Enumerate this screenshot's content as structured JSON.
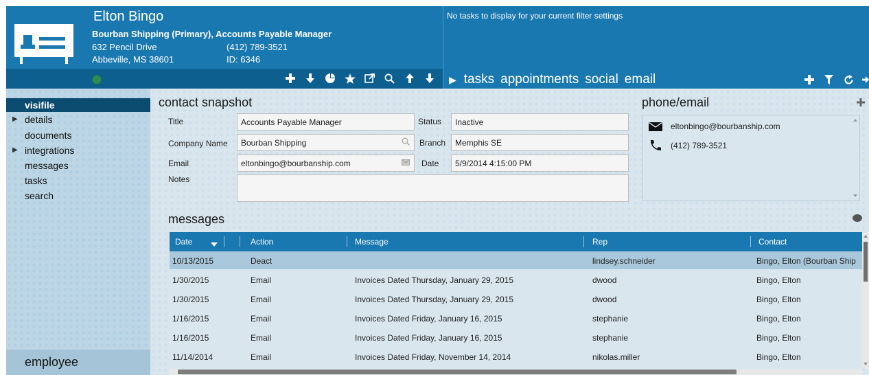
{
  "contact": {
    "name": "Elton Bingo",
    "company_line": "Bourban Shipping  (Primary), Accounts Payable Manager",
    "address1": "632 Pencil Drive",
    "address2": "Abbeville, MS  38601",
    "phone": "(412) 789-3521",
    "id": "ID:  6346",
    "status_color": "#2e8b57"
  },
  "card_toolbar": {
    "icons": [
      "plus-icon",
      "arrow-down-icon",
      "pie-icon",
      "star-icon",
      "external-link-icon",
      "search-icon",
      "arrow-up-icon",
      "arrow-down-icon"
    ]
  },
  "tasks": {
    "empty_message": "No tasks to display for your current filter settings",
    "tabs": [
      "tasks",
      "appointments",
      "social",
      "email"
    ],
    "tools": [
      "plus-icon",
      "filter-icon",
      "refresh-icon",
      "arrow-right-icon"
    ]
  },
  "nav": {
    "items": [
      {
        "label": "visifile",
        "active": true,
        "expandable": false
      },
      {
        "label": "details",
        "active": false,
        "expandable": true
      },
      {
        "label": "documents",
        "active": false,
        "expandable": false
      },
      {
        "label": "integrations",
        "active": false,
        "expandable": true
      },
      {
        "label": "messages",
        "active": false,
        "expandable": false
      },
      {
        "label": "tasks",
        "active": false,
        "expandable": false
      },
      {
        "label": "search",
        "active": false,
        "expandable": false
      }
    ],
    "footer": "employee"
  },
  "snapshot": {
    "title": "contact snapshot",
    "fields": {
      "title_label": "Title",
      "title_value": "Accounts Payable Manager",
      "company_label": "Company Name",
      "company_value": "Bourban Shipping",
      "email_label": "Email",
      "email_value": "eltonbingo@bourbanship.com",
      "notes_label": "Notes",
      "notes_value": "",
      "status_label": "Status",
      "status_value": "Inactive",
      "branch_label": "Branch",
      "branch_value": "Memphis SE",
      "date_label": "Date",
      "date_value": "5/9/2014 4:15:00 PM"
    }
  },
  "phone_email": {
    "title": "phone/email",
    "email": "eltonbingo@bourbanship.com",
    "phone": "(412) 789-3521"
  },
  "messages": {
    "title": "messages",
    "columns": [
      "Date",
      "Action",
      "Message",
      "Rep",
      "Contact"
    ],
    "rows": [
      {
        "date": "10/13/2015",
        "action": "Deact",
        "message": "",
        "rep": "lindsey.schneider",
        "contact": "Bingo, Elton (Bourban Ship",
        "selected": true
      },
      {
        "date": "1/30/2015",
        "action": "Email",
        "message": "Invoices Dated Thursday, January 29, 2015",
        "rep": "dwood",
        "contact": "Bingo, Elton",
        "selected": false
      },
      {
        "date": "1/30/2015",
        "action": "Email",
        "message": "Invoices Dated Thursday, January 29, 2015",
        "rep": "dwood",
        "contact": "Bingo, Elton",
        "selected": false
      },
      {
        "date": "1/16/2015",
        "action": "Email",
        "message": "Invoices Dated Friday, January 16, 2015",
        "rep": "stephanie",
        "contact": "Bingo, Elton",
        "selected": false
      },
      {
        "date": "1/16/2015",
        "action": "Email",
        "message": "Invoices Dated Friday, January 16, 2015",
        "rep": "stephanie",
        "contact": "Bingo, Elton",
        "selected": false
      },
      {
        "date": "11/14/2014",
        "action": "Email",
        "message": "Invoices Dated Friday, November 14, 2014",
        "rep": "nikolas.miller",
        "contact": "Bingo, Elton",
        "selected": false
      }
    ]
  }
}
